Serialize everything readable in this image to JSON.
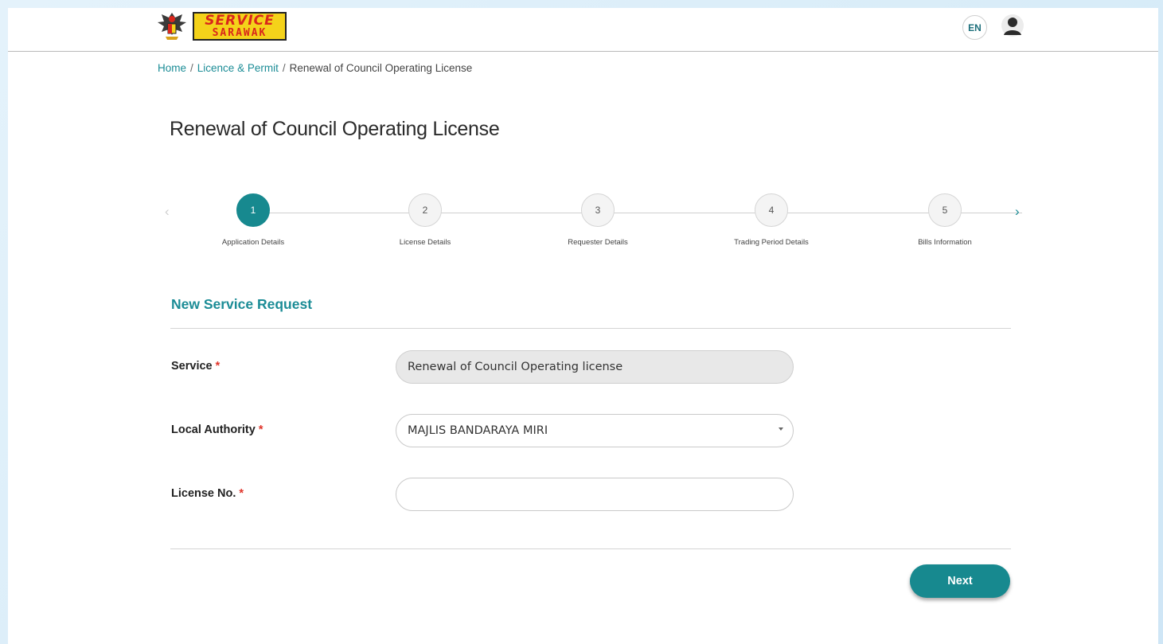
{
  "header": {
    "logo_line1": "SERVICE",
    "logo_line2": "SARAWAK",
    "lang": "EN"
  },
  "breadcrumb": {
    "home": "Home",
    "separator": "/",
    "licence": "Licence & Permit",
    "current": "Renewal of Council Operating License"
  },
  "page": {
    "title": "Renewal of Council Operating License"
  },
  "stepper": {
    "prev_arrow": "‹",
    "next_arrow": "›",
    "steps": [
      {
        "number": "1",
        "label": "Application Details",
        "active": true
      },
      {
        "number": "2",
        "label": "License Details",
        "active": false
      },
      {
        "number": "3",
        "label": "Requester Details",
        "active": false
      },
      {
        "number": "4",
        "label": "Trading Period Details",
        "active": false
      },
      {
        "number": "5",
        "label": "Bills Information",
        "active": false
      }
    ]
  },
  "form": {
    "section_title": "New Service Request",
    "required_marker": "*",
    "service_label": "Service",
    "service_value": "Renewal of Council Operating license",
    "authority_label": "Local Authority",
    "authority_value": "MAJLIS BANDARAYA MIRI",
    "license_label": "License No.",
    "license_value": "",
    "next_label": "Next"
  },
  "colors": {
    "accent": "#17898f",
    "link": "#1b8c96",
    "required": "#e0342a"
  }
}
